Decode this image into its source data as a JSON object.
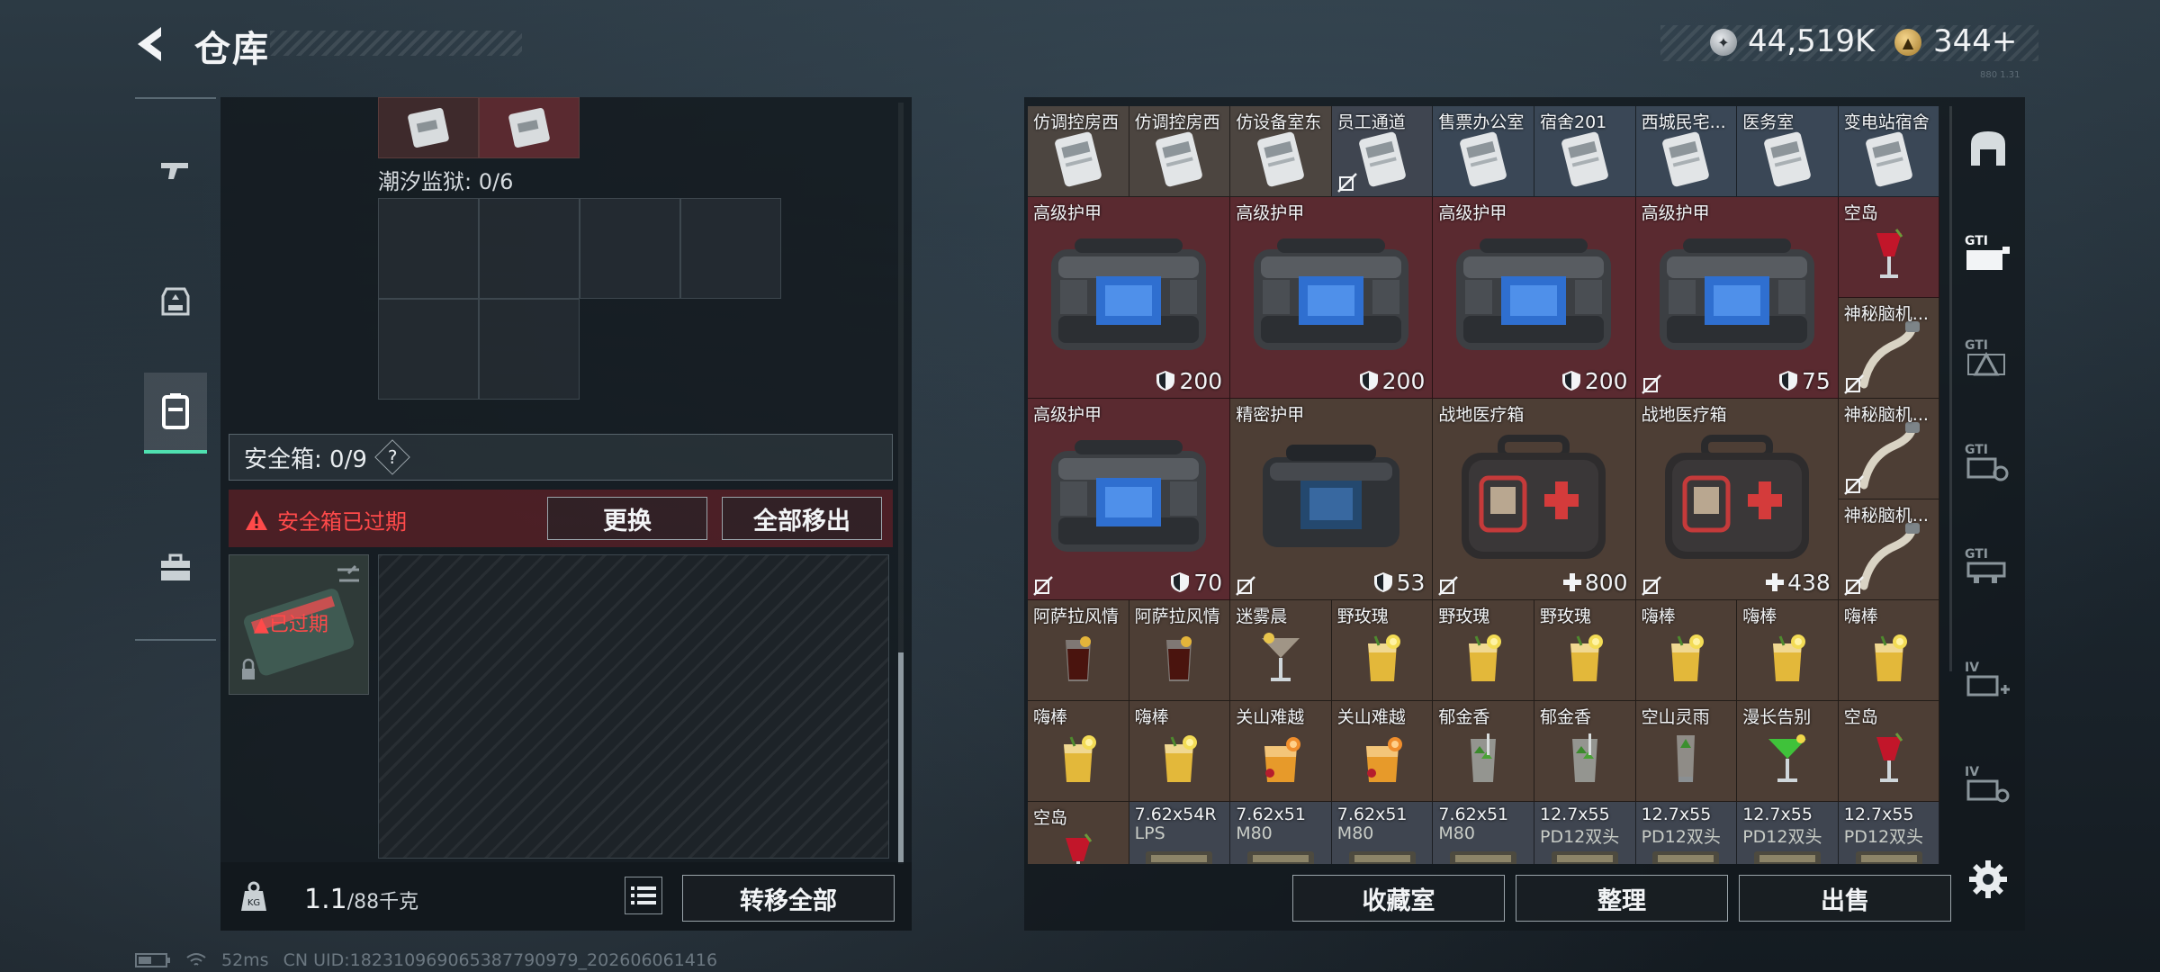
{
  "header": {
    "title": "仓库",
    "currency_silver": "44,519K",
    "currency_gold": "344+",
    "version": "880 1.31"
  },
  "nav": {
    "items": [
      "weapon",
      "armor",
      "backpack",
      "toolbox"
    ],
    "active": 2
  },
  "left_panel": {
    "prison_label": "潮汐监狱: 0/6",
    "safebox_header": "安全箱: 0/9",
    "help_mark": "?",
    "expired_warning": "安全箱已过期",
    "replace_btn": "更换",
    "remove_all_btn": "全部移出",
    "safebox_status": "已过期"
  },
  "bottom_left": {
    "weight": "1.1",
    "weight_max": "/88千克",
    "transfer_all": "转移全部"
  },
  "status": {
    "ping": "52ms",
    "uid": "CN UID:18231096906538779097​9_202606061416"
  },
  "stash": {
    "keys": [
      {
        "name": "仿调控房西",
        "bg": "key"
      },
      {
        "name": "仿调控房西",
        "bg": "key"
      },
      {
        "name": "仿设备室东",
        "bg": "key"
      },
      {
        "name": "员工通道",
        "bg": "grey",
        "noloot": true
      },
      {
        "name": "售票办公室",
        "bg": "blue"
      },
      {
        "name": "宿舍201",
        "bg": "blue"
      },
      {
        "name": "西城民宅...",
        "bg": "blue"
      },
      {
        "name": "医务室",
        "bg": "blue"
      },
      {
        "name": "变电站宿舍",
        "bg": "blue"
      }
    ],
    "armor_row1": [
      {
        "name": "高级护甲",
        "value": "200"
      },
      {
        "name": "高级护甲",
        "value": "200"
      },
      {
        "name": "高级护甲",
        "value": "200"
      },
      {
        "name": "高级护甲",
        "value": "75",
        "noloot": true
      }
    ],
    "side_items": [
      {
        "name": "空岛",
        "kind": "cocktail-red"
      },
      {
        "name": "神秘脑机...",
        "kind": "cable",
        "noloot": true
      },
      {
        "name": "神秘脑机...",
        "kind": "cable",
        "noloot": true
      },
      {
        "name": "神秘脑机...",
        "kind": "cable",
        "noloot": true
      }
    ],
    "row2": [
      {
        "name": "高级护甲",
        "value": "70",
        "icon": "shield",
        "bg": "red",
        "kind": "armor",
        "noloot": true
      },
      {
        "name": "精密护甲",
        "value": "53",
        "icon": "shield",
        "bg": "brown",
        "kind": "armor-dark",
        "noloot": true
      },
      {
        "name": "战地医疗箱",
        "value": "800",
        "icon": "plus",
        "bg": "brown",
        "kind": "medkit",
        "noloot": true
      },
      {
        "name": "战地医疗箱",
        "value": "438",
        "icon": "plus",
        "bg": "brown",
        "kind": "medkit",
        "noloot": true
      }
    ],
    "drinks_row1": [
      {
        "name": "阿萨拉风情",
        "kind": "cola"
      },
      {
        "name": "阿萨拉风情",
        "kind": "cola"
      },
      {
        "name": "迷雾晨",
        "kind": "martini"
      },
      {
        "name": "野玫瑰",
        "kind": "lemon"
      },
      {
        "name": "野玫瑰",
        "kind": "lemon"
      },
      {
        "name": "野玫瑰",
        "kind": "lemon"
      },
      {
        "name": "嗨棒",
        "kind": "lemon"
      },
      {
        "name": "嗨棒",
        "kind": "lemon"
      },
      {
        "name": "嗨棒",
        "kind": "lemon"
      }
    ],
    "drinks_row2": [
      {
        "name": "嗨棒",
        "kind": "lemon"
      },
      {
        "name": "嗨棒",
        "kind": "lemon"
      },
      {
        "name": "关山难越",
        "kind": "orange"
      },
      {
        "name": "关山难越",
        "kind": "orange"
      },
      {
        "name": "郁金香",
        "kind": "mojito"
      },
      {
        "name": "郁金香",
        "kind": "mojito"
      },
      {
        "name": "空山灵雨",
        "kind": "tall"
      },
      {
        "name": "漫长告别",
        "kind": "green"
      },
      {
        "name": "空岛",
        "kind": "cocktail-red"
      }
    ],
    "ammo_row": [
      {
        "name": "空岛",
        "kind": "cocktail-red",
        "bg": "brown"
      },
      {
        "name": "7.62x54R",
        "sub": "LPS",
        "bg": "grey"
      },
      {
        "name": "7.62x51",
        "sub": "M80",
        "bg": "grey"
      },
      {
        "name": "7.62x51",
        "sub": "M80",
        "bg": "grey"
      },
      {
        "name": "7.62x51",
        "sub": "M80",
        "bg": "grey"
      },
      {
        "name": "12.7x55",
        "sub": "PD12双头",
        "bg": "grey"
      },
      {
        "name": "12.7x55",
        "sub": "PD12双头",
        "bg": "grey"
      },
      {
        "name": "12.7x55",
        "sub": "PD12双头",
        "bg": "grey"
      },
      {
        "name": "12.7x55",
        "sub": "PD12双头",
        "bg": "grey"
      }
    ]
  },
  "right_side": {
    "tabs": [
      "safe-room",
      "GTI-1",
      "GTI-2",
      "GTI-3",
      "GTI-4",
      "IV-1",
      "IV-2"
    ]
  },
  "bottom_right": {
    "collection": "收藏室",
    "sort": "整理",
    "sell": "出售"
  }
}
